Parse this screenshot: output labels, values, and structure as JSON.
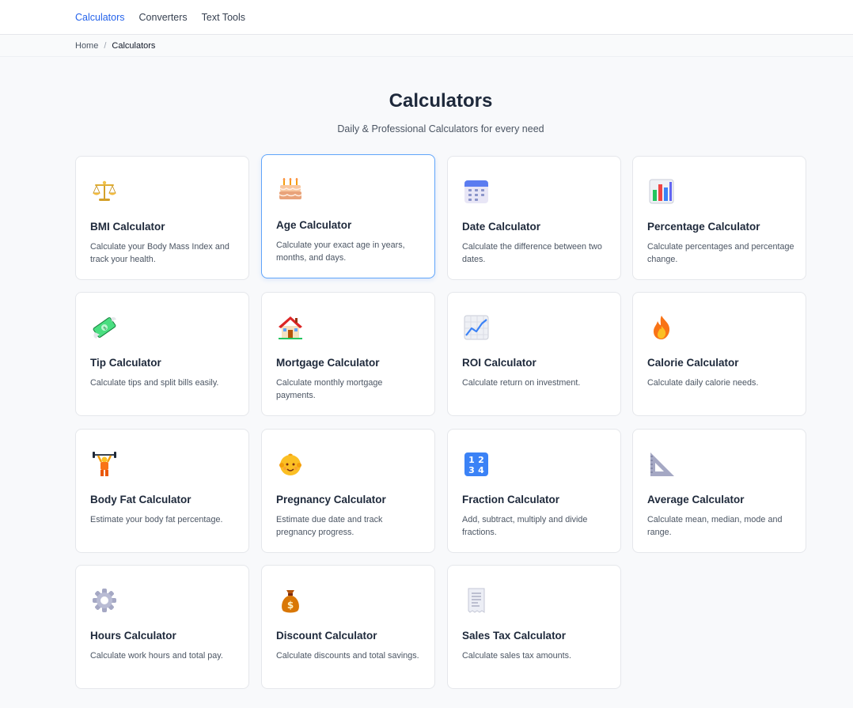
{
  "nav": {
    "items": [
      "Calculators",
      "Converters",
      "Text Tools"
    ]
  },
  "breadcrumb": {
    "home": "Home",
    "separator": "/",
    "current": "Calculators"
  },
  "page": {
    "title": "Calculators",
    "subtitle": "Daily & Professional Calculators for every need"
  },
  "cards": [
    {
      "title": "BMI Calculator",
      "desc": "Calculate your Body Mass Index and track your health.",
      "icon": "scales-icon"
    },
    {
      "title": "Age Calculator",
      "desc": "Calculate your exact age in years, months, and days.",
      "icon": "birthday-cake-icon"
    },
    {
      "title": "Date Calculator",
      "desc": "Calculate the difference between two dates.",
      "icon": "calendar-icon"
    },
    {
      "title": "Percentage Calculator",
      "desc": "Calculate percentages and percentage change.",
      "icon": "bar-chart-icon"
    },
    {
      "title": "Tip Calculator",
      "desc": "Calculate tips and split bills easily.",
      "icon": "money-with-wings-icon"
    },
    {
      "title": "Mortgage Calculator",
      "desc": "Calculate monthly mortgage payments.",
      "icon": "house-icon"
    },
    {
      "title": "ROI Calculator",
      "desc": "Calculate return on investment.",
      "icon": "trending-up-chart-icon"
    },
    {
      "title": "Calorie Calculator",
      "desc": "Calculate daily calorie needs.",
      "icon": "fire-icon"
    },
    {
      "title": "Body Fat Calculator",
      "desc": "Estimate your body fat percentage.",
      "icon": "weightlifter-icon"
    },
    {
      "title": "Pregnancy Calculator",
      "desc": "Estimate due date and track pregnancy progress.",
      "icon": "baby-icon"
    },
    {
      "title": "Fraction Calculator",
      "desc": "Add, subtract, multiply and divide fractions.",
      "icon": "numbers-1234-icon"
    },
    {
      "title": "Average Calculator",
      "desc": "Calculate mean, median, mode and range.",
      "icon": "triangular-ruler-icon"
    },
    {
      "title": "Hours Calculator",
      "desc": "Calculate work hours and total pay.",
      "icon": "gear-icon"
    },
    {
      "title": "Discount Calculator",
      "desc": "Calculate discounts and total savings.",
      "icon": "money-bag-icon"
    },
    {
      "title": "Sales Tax Calculator",
      "desc": "Calculate sales tax amounts.",
      "icon": "receipt-icon"
    }
  ],
  "colors": {
    "accent": "#2563eb",
    "hover_border": "#60a5fa",
    "background": "#f8f9fb"
  }
}
